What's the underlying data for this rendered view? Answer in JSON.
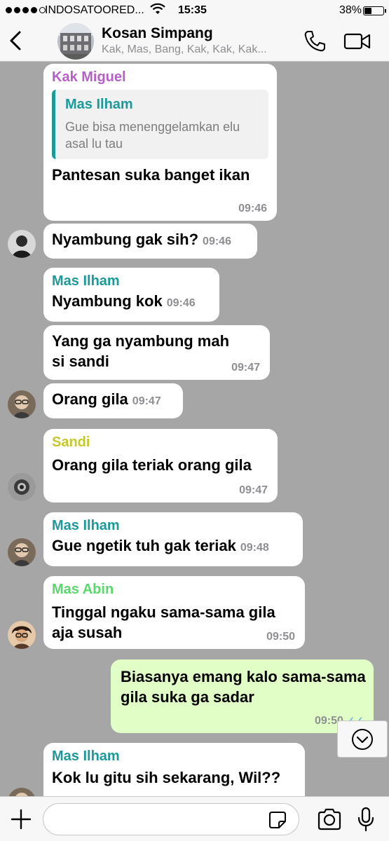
{
  "status_bar": {
    "carrier": "INDOSATOORED...",
    "time": "15:35",
    "battery": "38%",
    "battery_level": 0.38
  },
  "header": {
    "back_icon": "chevron-left-icon",
    "title": "Kosan Simpang",
    "members": "Kak, Mas, Bang, Kak, Kak, Kak...",
    "call_icon": "phone-icon",
    "video_icon": "video-camera-icon"
  },
  "colors": {
    "chat_bg": "#a6a6a6",
    "incoming_bubble": "#ffffff",
    "outgoing_bubble": "#e1fec6",
    "kak_miguel": "#b65fc7",
    "mas_ilham": "#1c9a9a",
    "sandi": "#c6c82a",
    "mas_abin": "#59d96a"
  },
  "messages": [
    {
      "sender": "Kak Miguel",
      "quote": {
        "name": "Mas Ilham",
        "text": "Gue bisa menenggelamkan elu asal lu tau"
      },
      "text": "Pantesan suka banget ikan",
      "time": "09:46"
    },
    {
      "text": "Nyambung gak sih?",
      "time": "09:46"
    },
    {
      "sender": "Mas Ilham",
      "text": "Nyambung kok",
      "time": "09:46"
    },
    {
      "text": "Yang ga nyambung mah si sandi",
      "time": "09:47"
    },
    {
      "text": "Orang gila",
      "time": "09:47"
    },
    {
      "sender": "Sandi",
      "text": "Orang gila teriak orang gila",
      "time": "09:47"
    },
    {
      "sender": "Mas Ilham",
      "text": "Gue ngetik tuh gak teriak",
      "time": "09:48"
    },
    {
      "sender": "Mas Abin",
      "text": "Tinggal ngaku sama-sama gila aja susah",
      "time": "09:50"
    },
    {
      "text": "Biasanya emang kalo sama-sama gila suka ga sadar",
      "time": "09:50",
      "ticks": "✓✓"
    },
    {
      "sender": "Mas Ilham",
      "text": "Kok lu gitu sih sekarang, Wil??"
    }
  ],
  "input": {
    "placeholder": "",
    "plus_icon": "plus-icon",
    "sticker_icon": "sticker-icon",
    "camera_icon": "camera-icon",
    "mic_icon": "microphone-icon",
    "scroll_icon": "chevron-down-circle-icon"
  }
}
